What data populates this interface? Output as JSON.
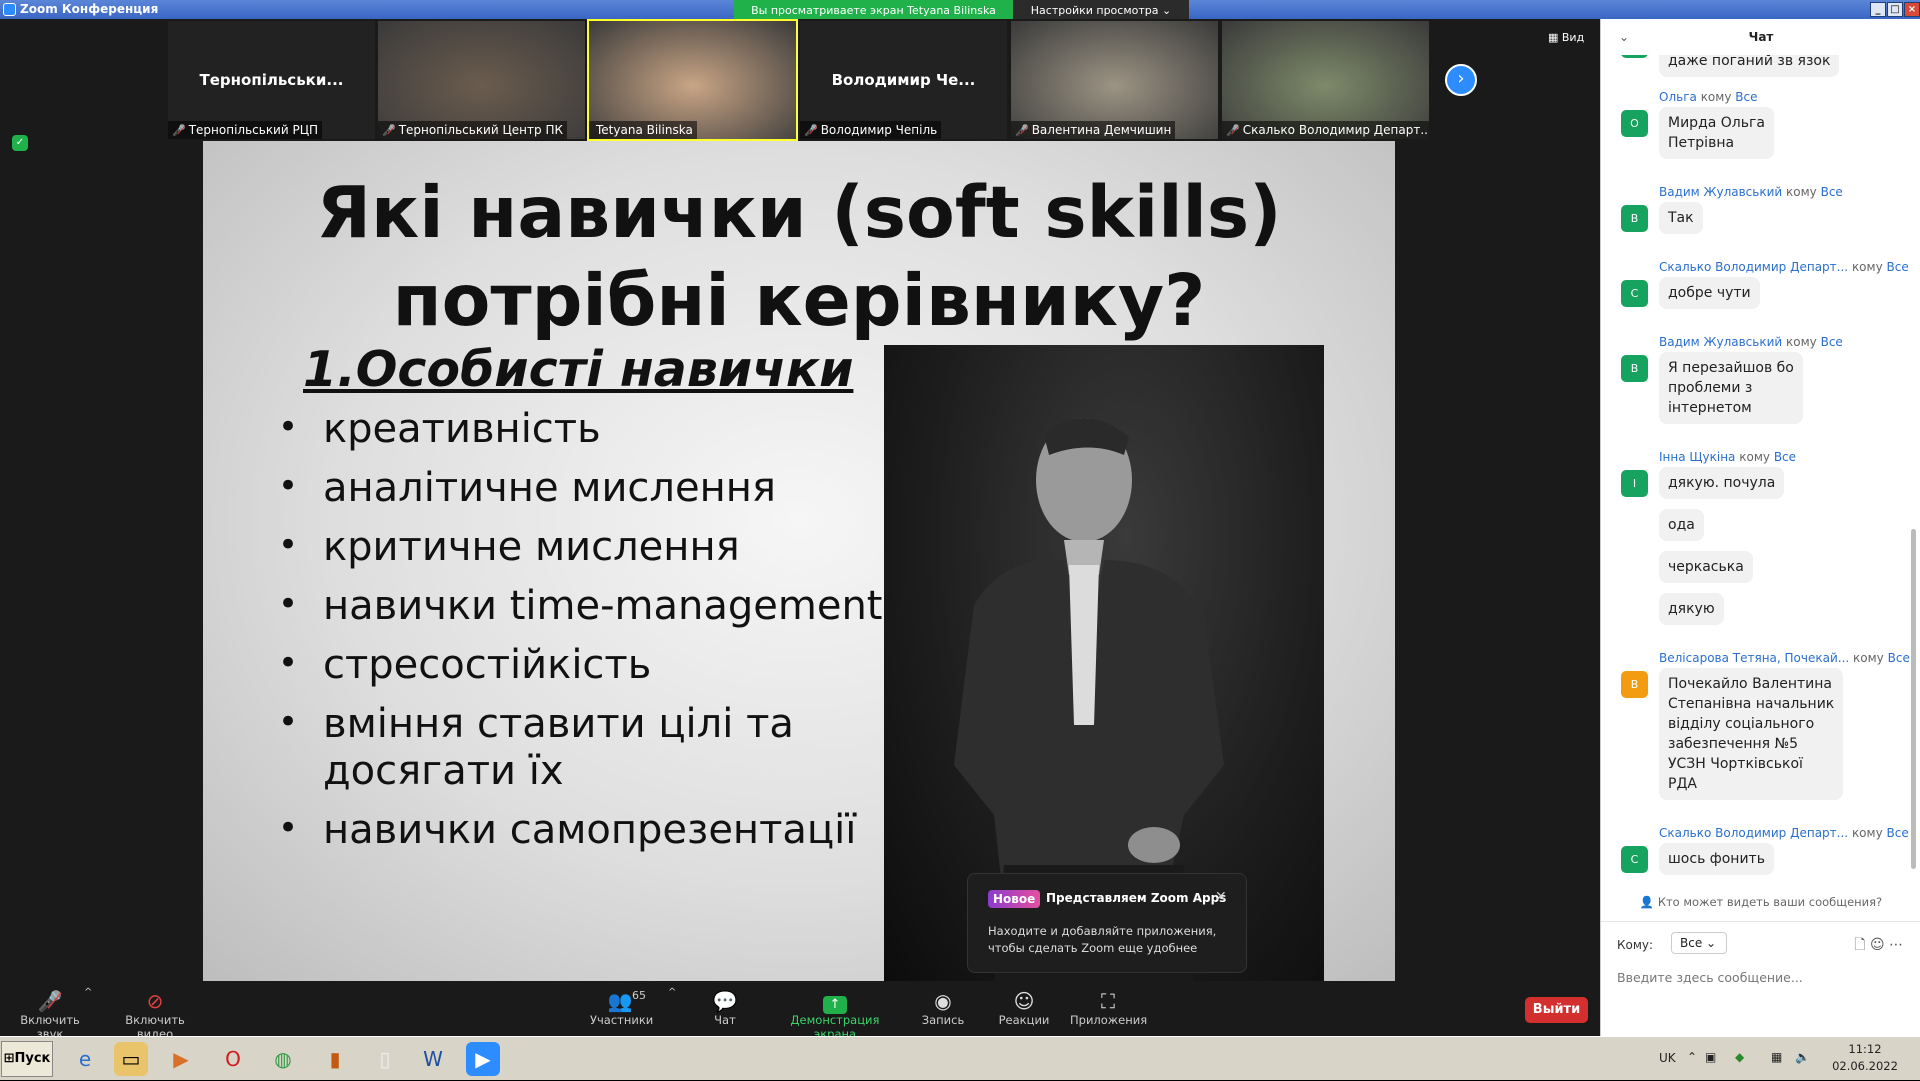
{
  "window": {
    "title": "Zoom Конференция"
  },
  "share_banner": {
    "text": "Вы просматриваете экран Tetyana Bilinska",
    "view_options": "Настройки просмотра ⌄"
  },
  "view_button": "Вид",
  "participants": [
    {
      "display": "Тернопільськи...",
      "label": "Тернопільський РЦП",
      "video": false
    },
    {
      "display": "",
      "label": "Тернопільський Центр ПК",
      "video": true,
      "tone": "#6b5c4e"
    },
    {
      "display": "",
      "label": "Tetyana Bilinska",
      "video": true,
      "tone": "#c9a585",
      "active": true
    },
    {
      "display": "Володимир  Че...",
      "label": "Володимир Чепіль",
      "video": false
    },
    {
      "display": "",
      "label": "Валентина Демчишин",
      "video": true,
      "tone": "#9c9484"
    },
    {
      "display": "",
      "label": "Скалько Володимир Департ...",
      "video": true,
      "tone": "#7e8a6a"
    }
  ],
  "slide": {
    "title_line1": "Які навички (soft skills)",
    "title_line2": "потрібні керівнику?",
    "subtitle": "1.Особисті навички",
    "bullets": [
      "креативність",
      "аналітичне мислення",
      "критичне мислення",
      "навички time-management",
      "стресостійкість",
      "вміння ставити цілі та досягати їх",
      "навички самопрезентації"
    ]
  },
  "apps_popup": {
    "badge": "Новое",
    "title": "Представляем Zoom Apps",
    "text": "Находите и добавляйте приложения, чтобы сделать Zoom еще удобнее"
  },
  "toolbar": {
    "audio": "Включить звук",
    "video": "Включить видео",
    "participants": "Участники",
    "participants_count": "65",
    "chat": "Чат",
    "share": "Демонстрация экрана",
    "record": "Запись",
    "reactions": "Реакции",
    "apps": "Приложения",
    "leave": "Выйти"
  },
  "chat": {
    "header": "Чат",
    "to_word": "кому",
    "all": "Все",
    "messages": [
      {
        "top_bubble": "даже поганий зв язок"
      },
      {
        "sender": "Ольга",
        "avatar": "О",
        "lines": [
          "Мирда Ольга",
          "Петрівна"
        ]
      },
      {
        "sender": "Вадим Жулавський",
        "avatar": "В",
        "lines": [
          "Так"
        ]
      },
      {
        "sender": "Скалько Володимир Департ...",
        "avatar": "С",
        "lines": [
          "добре чути"
        ]
      },
      {
        "sender": "Вадим Жулавський",
        "avatar": "В",
        "lines": [
          "Я перезайшов бо",
          "проблеми з",
          "інтернетом"
        ]
      },
      {
        "sender": "Інна Щукіна",
        "avatar": "І",
        "lines": [
          "дякую. почула"
        ],
        "extra": [
          "ода",
          "черкаська",
          "дякую"
        ]
      },
      {
        "sender": "Велісарова Тетяна, Почекай...",
        "avatar": "В",
        "orange": true,
        "lines": [
          "Почекайло Валентина",
          "Степанівна начальник",
          "відділу соціального",
          "забезпечення №5",
          "УСЗН Чортківської",
          "РДА"
        ]
      },
      {
        "sender": "Скалько Володимир Департ...",
        "avatar": "С",
        "lines": [
          "шось фонить"
        ]
      }
    ],
    "who_can_see": "Кто может видеть ваши сообщения?",
    "to_label": "Кому:",
    "to_value": "Все",
    "input_placeholder": "Введите здесь сообщение..."
  },
  "taskbar": {
    "start": "Пуск",
    "lang": "UK",
    "time": "11:12",
    "date": "02.06.2022"
  }
}
